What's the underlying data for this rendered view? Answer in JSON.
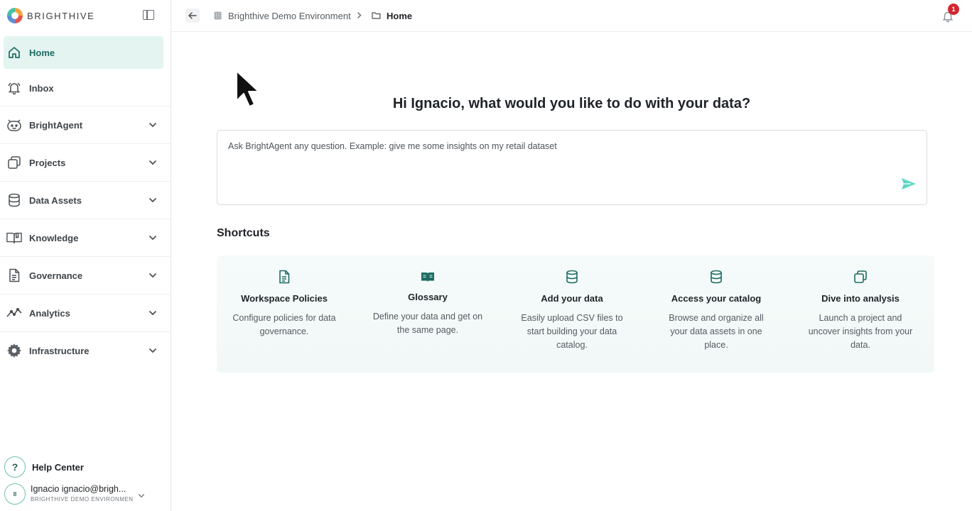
{
  "brand": {
    "name": "BRIGHTHIVE"
  },
  "sidebar": {
    "items": [
      {
        "label": "Home"
      },
      {
        "label": "Inbox"
      },
      {
        "label": "BrightAgent"
      },
      {
        "label": "Projects"
      },
      {
        "label": "Data Assets"
      },
      {
        "label": "Knowledge"
      },
      {
        "label": "Governance"
      },
      {
        "label": "Analytics"
      },
      {
        "label": "Infrastructure"
      }
    ],
    "help_label": "Help Center",
    "help_glyph": "?",
    "user": {
      "initials": "II",
      "name": "Ignacio ignacio@brigh...",
      "environment": "BRIGHTHIVE DEMO ENVIRONMENT"
    }
  },
  "topbar": {
    "breadcrumb": {
      "environment": "Brighthive Demo Environment",
      "current": "Home"
    },
    "notifications": {
      "count": "1"
    }
  },
  "main": {
    "greeting": "Hi Ignacio, what would you like to do with your data?",
    "ask": {
      "placeholder": "Ask BrightAgent any question. Example: give me some insights on my retail dataset",
      "value": ""
    },
    "shortcuts_title": "Shortcuts",
    "shortcuts": [
      {
        "title": "Workspace Policies",
        "description": "Configure policies for data governance.",
        "icon": "document-icon"
      },
      {
        "title": "Glossary",
        "description": "Define your data and get on the same page.",
        "icon": "book-icon"
      },
      {
        "title": "Add your data",
        "description": "Easily upload CSV files to start building your data catalog.",
        "icon": "database-icon"
      },
      {
        "title": "Access your catalog",
        "description": "Browse and organize all your data assets in one place.",
        "icon": "database-icon"
      },
      {
        "title": "Dive into analysis",
        "description": "Launch a project and uncover insights from your data.",
        "icon": "copy-icon"
      }
    ]
  },
  "colors": {
    "accent": "#1d6b62",
    "active_bg": "#e4f4f1",
    "send": "#4fd1c0",
    "badge": "#d3262f"
  }
}
